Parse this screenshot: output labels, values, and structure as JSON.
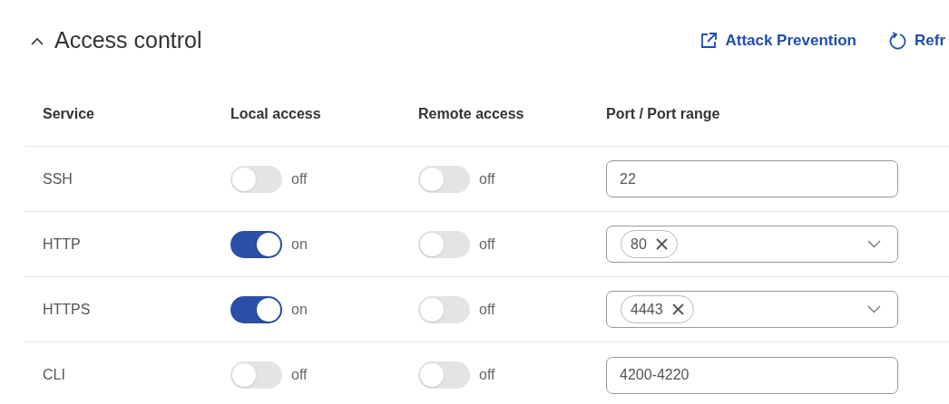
{
  "section": {
    "title": "Access control",
    "expanded": true
  },
  "actions": [
    {
      "kind": "external",
      "label": "Attack Prevention"
    },
    {
      "kind": "refresh",
      "label": "Refr"
    }
  ],
  "table": {
    "columns": [
      "Service",
      "Local access",
      "Remote access",
      "Port / Port range"
    ],
    "rows": [
      {
        "service": "SSH",
        "local": {
          "on": false,
          "label": "off"
        },
        "remote": {
          "on": false,
          "label": "off"
        },
        "port": {
          "kind": "text",
          "value": "22"
        }
      },
      {
        "service": "HTTP",
        "local": {
          "on": true,
          "label": "on"
        },
        "remote": {
          "on": false,
          "label": "off"
        },
        "port": {
          "kind": "tags",
          "tags": [
            "80"
          ]
        }
      },
      {
        "service": "HTTPS",
        "local": {
          "on": true,
          "label": "on"
        },
        "remote": {
          "on": false,
          "label": "off"
        },
        "port": {
          "kind": "tags",
          "tags": [
            "4443"
          ]
        }
      },
      {
        "service": "CLI",
        "local": {
          "on": false,
          "label": "off"
        },
        "remote": {
          "on": false,
          "label": "off"
        },
        "port": {
          "kind": "text",
          "value": "4200-4220"
        }
      }
    ]
  }
}
